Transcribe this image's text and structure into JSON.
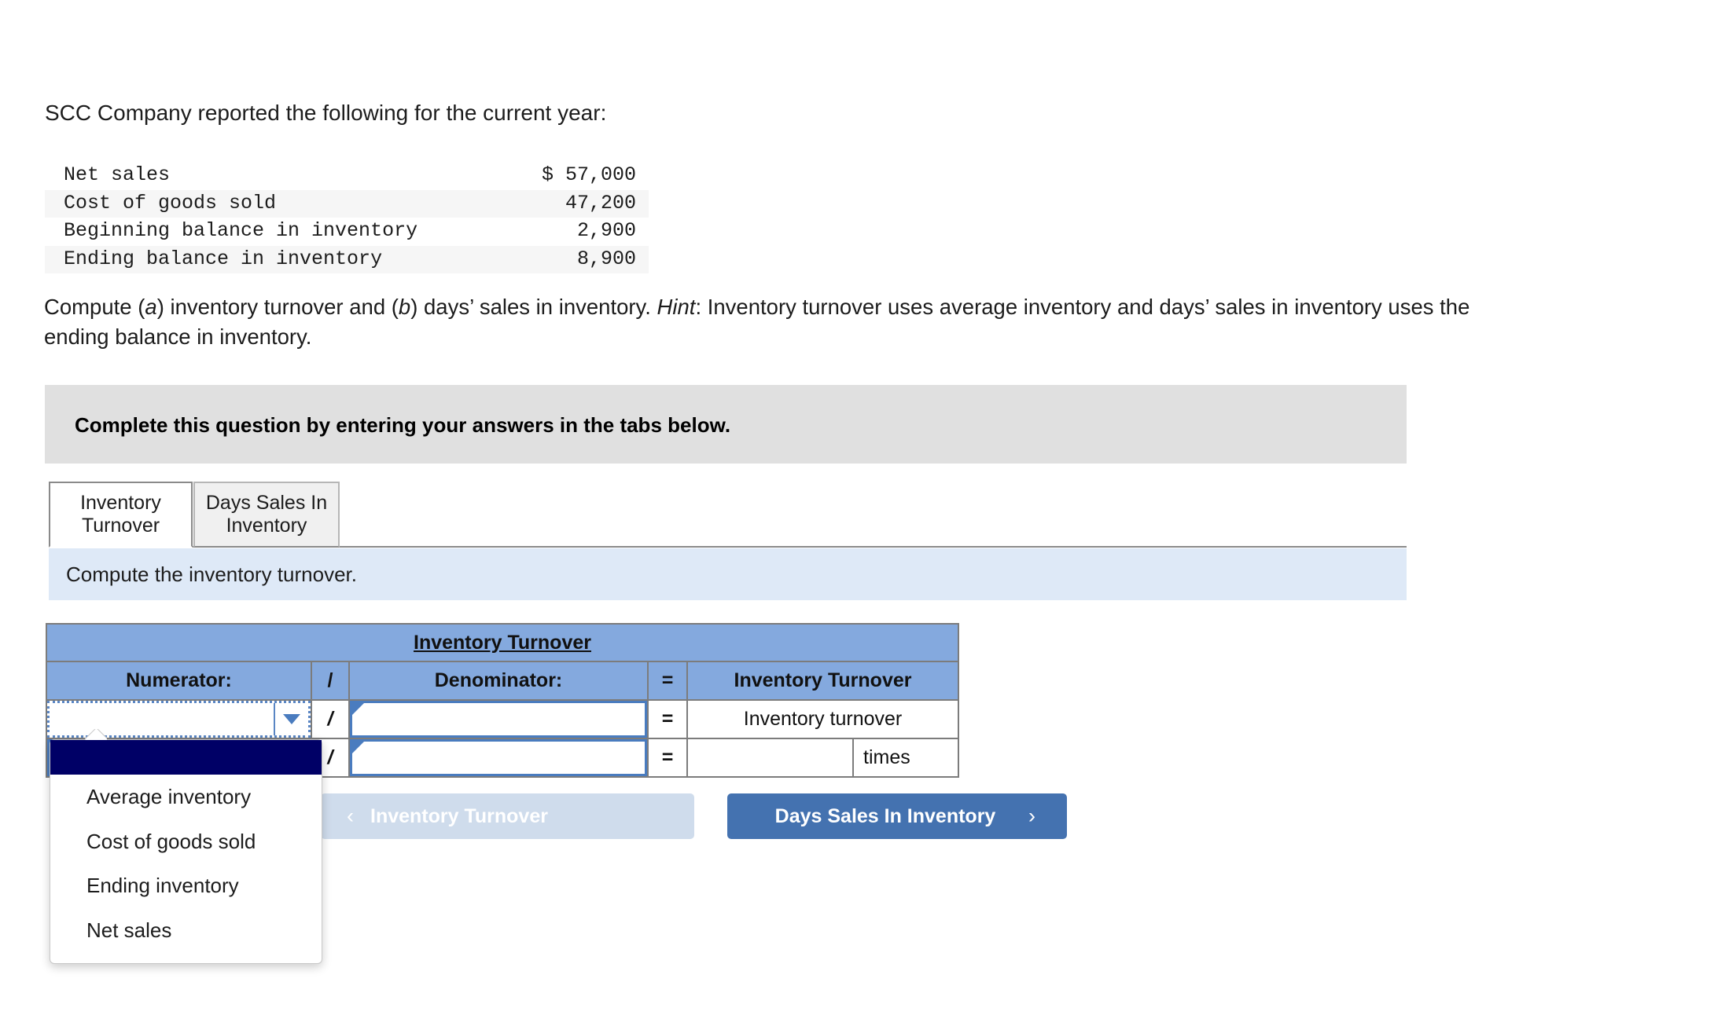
{
  "intro": {
    "text": "SCC Company reported the following for the current year:"
  },
  "financials": {
    "rows": [
      {
        "label": "Net sales",
        "amount": "$ 57,000"
      },
      {
        "label": "Cost of goods sold",
        "amount": "47,200"
      },
      {
        "label": "Beginning balance in inventory",
        "amount": "2,900"
      },
      {
        "label": "Ending balance in inventory",
        "amount": "8,900"
      }
    ]
  },
  "prompt": {
    "part1": "Compute (",
    "a": "a",
    "part2": ") inventory turnover and (",
    "b": "b",
    "part3": ") days’ sales in inventory. ",
    "hint_label": "Hint",
    "part4": ": Inventory turnover uses average inventory and days’ sales in inventory uses the ending balance in inventory."
  },
  "instruction_band": {
    "text": "Complete this question by entering your answers in the tabs below."
  },
  "tabs": {
    "items": [
      {
        "label_line1": "Inventory",
        "label_line2": "Turnover",
        "active": true
      },
      {
        "label_line1": "Days Sales In",
        "label_line2": "Inventory",
        "active": false
      }
    ]
  },
  "sub_instruction": {
    "text": "Compute the inventory turnover."
  },
  "grid": {
    "title": "Inventory Turnover",
    "headers": {
      "numerator": "Numerator:",
      "slash": "/",
      "denominator": "Denominator:",
      "equals": "=",
      "result": "Inventory Turnover"
    },
    "row1": {
      "numerator_value": "",
      "slash": "/",
      "denominator_value": "",
      "equals": "=",
      "result_label": "Inventory turnover"
    },
    "row2": {
      "numerator_value": "",
      "slash": "/",
      "denominator_value": "",
      "equals": "=",
      "result_value": "",
      "result_unit": "times"
    }
  },
  "dropdown": {
    "options": [
      {
        "label": "",
        "selected": true
      },
      {
        "label": "Average inventory",
        "selected": false
      },
      {
        "label": "Cost of goods sold",
        "selected": false
      },
      {
        "label": "Ending inventory",
        "selected": false
      },
      {
        "label": "Net sales",
        "selected": false
      }
    ]
  },
  "nav": {
    "prev_label": "Inventory Turnover",
    "prev_chevron": "‹",
    "next_label": "Days Sales In Inventory",
    "next_chevron": "›"
  },
  "colors": {
    "header_blue": "#84a9de",
    "light_blue": "#dee9f7",
    "gray_band": "#e0e0e0",
    "accent_blue": "#4472b0",
    "navy_select": "#000066",
    "input_border": "#4a7cbf"
  }
}
